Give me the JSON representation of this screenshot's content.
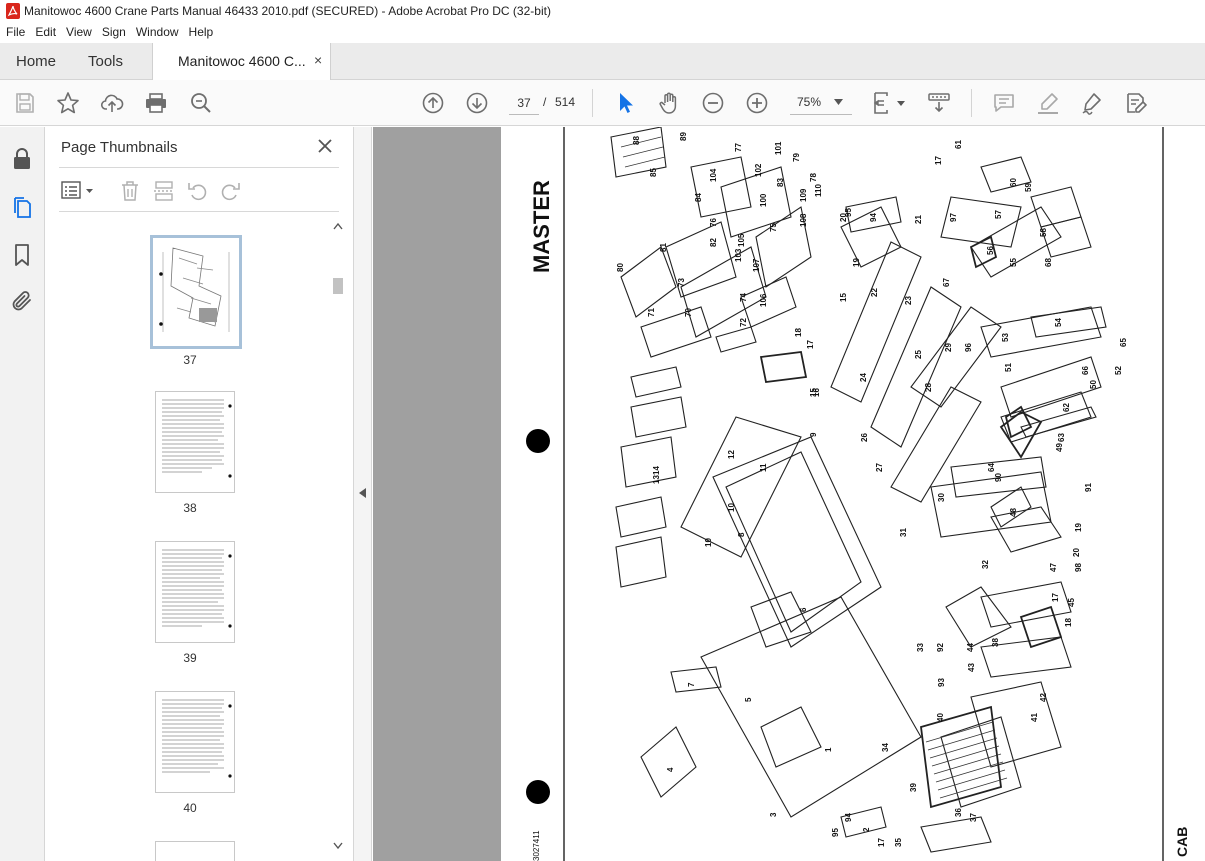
{
  "window": {
    "title": "Manitowoc 4600 Crane Parts Manual 46433 2010.pdf (SECURED) - Adobe Acrobat Pro DC (32-bit)"
  },
  "menu": [
    "File",
    "Edit",
    "View",
    "Sign",
    "Window",
    "Help"
  ],
  "tabs": {
    "home": "Home",
    "tools": "Tools",
    "document": "Manitowoc 4600 C...",
    "close_glyph": "×"
  },
  "toolbar": {
    "current_page": "37",
    "separator": "/",
    "total_pages": "514",
    "zoom": "75%"
  },
  "panel": {
    "title": "Page Thumbnails",
    "close_glyph": "×"
  },
  "thumbnails": [
    {
      "page": "37",
      "selected": true
    },
    {
      "page": "38",
      "selected": false
    },
    {
      "page": "39",
      "selected": false
    },
    {
      "page": "40",
      "selected": false
    }
  ],
  "document_page": {
    "heading": "MASTER",
    "corner_label": "CAB",
    "drawing_code": "3027411",
    "callouts": [
      {
        "n": "89"
      },
      {
        "n": "88"
      },
      {
        "n": "77"
      },
      {
        "n": "101"
      },
      {
        "n": "79"
      },
      {
        "n": "85"
      },
      {
        "n": "104"
      },
      {
        "n": "83"
      },
      {
        "n": "102"
      },
      {
        "n": "78"
      },
      {
        "n": "110"
      },
      {
        "n": "109"
      },
      {
        "n": "84"
      },
      {
        "n": "100"
      },
      {
        "n": "82"
      },
      {
        "n": "76"
      },
      {
        "n": "108"
      },
      {
        "n": "105"
      },
      {
        "n": "75"
      },
      {
        "n": "81"
      },
      {
        "n": "103"
      },
      {
        "n": "107"
      },
      {
        "n": "80"
      },
      {
        "n": "73"
      },
      {
        "n": "74"
      },
      {
        "n": "106"
      },
      {
        "n": "71"
      },
      {
        "n": "70"
      },
      {
        "n": "72"
      },
      {
        "n": "61"
      },
      {
        "n": "17"
      },
      {
        "n": "60"
      },
      {
        "n": "59"
      },
      {
        "n": "95"
      },
      {
        "n": "94"
      },
      {
        "n": "21"
      },
      {
        "n": "97"
      },
      {
        "n": "57"
      },
      {
        "n": "20"
      },
      {
        "n": "58"
      },
      {
        "n": "56"
      },
      {
        "n": "55"
      },
      {
        "n": "68"
      },
      {
        "n": "19"
      },
      {
        "n": "67"
      },
      {
        "n": "22"
      },
      {
        "n": "15"
      },
      {
        "n": "23"
      },
      {
        "n": "54"
      },
      {
        "n": "53"
      },
      {
        "n": "18"
      },
      {
        "n": "17"
      },
      {
        "n": "25"
      },
      {
        "n": "29"
      },
      {
        "n": "96"
      },
      {
        "n": "65"
      },
      {
        "n": "51"
      },
      {
        "n": "66"
      },
      {
        "n": "52"
      },
      {
        "n": "24"
      },
      {
        "n": "50"
      },
      {
        "n": "15"
      },
      {
        "n": "16"
      },
      {
        "n": "28"
      },
      {
        "n": "62"
      },
      {
        "n": "9"
      },
      {
        "n": "26"
      },
      {
        "n": "63"
      },
      {
        "n": "49"
      },
      {
        "n": "14"
      },
      {
        "n": "13"
      },
      {
        "n": "12"
      },
      {
        "n": "11"
      },
      {
        "n": "27"
      },
      {
        "n": "64"
      },
      {
        "n": "90"
      },
      {
        "n": "30"
      },
      {
        "n": "91"
      },
      {
        "n": "10"
      },
      {
        "n": "8"
      },
      {
        "n": "48"
      },
      {
        "n": "19"
      },
      {
        "n": "31"
      },
      {
        "n": "10"
      },
      {
        "n": "20"
      },
      {
        "n": "32"
      },
      {
        "n": "47"
      },
      {
        "n": "98"
      },
      {
        "n": "6"
      },
      {
        "n": "45"
      },
      {
        "n": "17"
      },
      {
        "n": "18"
      },
      {
        "n": "7"
      },
      {
        "n": "33"
      },
      {
        "n": "92"
      },
      {
        "n": "44"
      },
      {
        "n": "38"
      },
      {
        "n": "93"
      },
      {
        "n": "43"
      },
      {
        "n": "5"
      },
      {
        "n": "42"
      },
      {
        "n": "41"
      },
      {
        "n": "40"
      },
      {
        "n": "1"
      },
      {
        "n": "34"
      },
      {
        "n": "4"
      },
      {
        "n": "39"
      },
      {
        "n": "3"
      },
      {
        "n": "2"
      },
      {
        "n": "94"
      },
      {
        "n": "95"
      },
      {
        "n": "36"
      },
      {
        "n": "37"
      },
      {
        "n": "35"
      },
      {
        "n": "17"
      }
    ]
  },
  "colors": {
    "accent_blue": "#1473e6",
    "icon_gray": "#6e6e6e",
    "doc_background": "#a0a0a0",
    "pdf_red": "#d9261c"
  }
}
